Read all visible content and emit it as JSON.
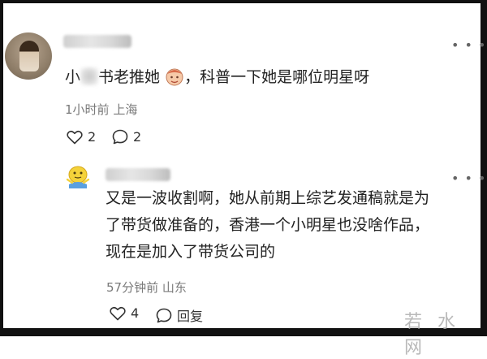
{
  "comments": [
    {
      "text_before": "小",
      "text_mid": "书老推她",
      "text_after": "，科普一下她是哪位明星呀",
      "emoji": "face-emoji",
      "time": "1小时前",
      "location": "上海",
      "likes": "2",
      "replies": "2"
    }
  ],
  "reply": {
    "lines": [
      "又是一波收割啊，她从前期上综艺发通稿就是为",
      "了带货做准备的，香港一个小明星也没啥作品，",
      "现在是加入了带货公司的"
    ],
    "time": "57分钟前",
    "location": "山东",
    "likes": "4",
    "reply_label": "回复"
  },
  "watermark": "若 水 网",
  "icons": {
    "more": "more-icon",
    "like": "heart-icon",
    "comment": "comment-icon"
  },
  "colors": {
    "text": "#222222",
    "meta": "#7a7a7a",
    "frame": "#111111"
  }
}
